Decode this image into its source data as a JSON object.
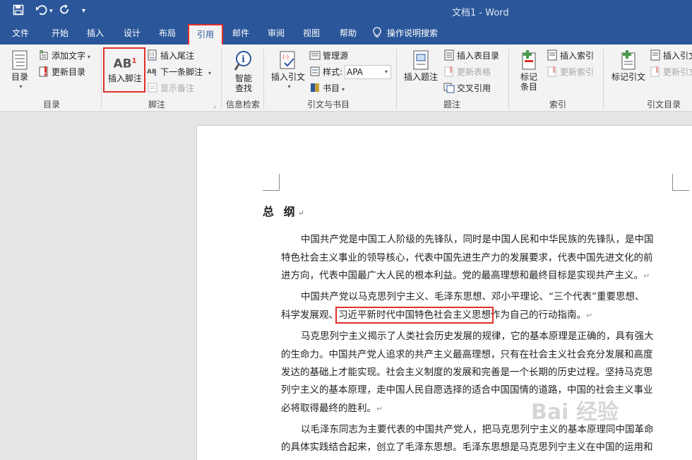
{
  "window": {
    "title": "文档1  -  Word"
  },
  "tabs": [
    "文件",
    "开始",
    "插入",
    "设计",
    "布局",
    "引用",
    "邮件",
    "审阅",
    "视图",
    "帮助"
  ],
  "tell_me": "操作说明搜索",
  "ribbon": {
    "toc": {
      "button": "目录",
      "add_text": "添加文字",
      "update_toc": "更新目录",
      "group": "目录"
    },
    "footnotes": {
      "insert_footnote": "插入脚注",
      "insert_endnote": "插入尾注",
      "next_footnote": "下一条脚注",
      "show_notes": "显示备注",
      "group": "脚注",
      "icon_text": "AB",
      "icon_sup": "1"
    },
    "research": {
      "smart_lookup_1": "智能",
      "smart_lookup_2": "查找",
      "group": "信息检索"
    },
    "citations": {
      "insert_citation": "插入引文",
      "manage_sources": "管理源",
      "style_label": "样式:",
      "style_value": "APA",
      "bibliography": "书目",
      "group": "引文与书目"
    },
    "captions": {
      "insert_caption": "插入题注",
      "insert_table_of_figures": "插入表目录",
      "update_table": "更新表格",
      "cross_reference": "交叉引用",
      "group": "题注"
    },
    "index": {
      "mark_entry_1": "标记",
      "mark_entry_2": "条目",
      "insert_index": "插入索引",
      "update_index": "更新索引",
      "group": "索引"
    },
    "toa": {
      "mark_citation": "标记引文",
      "insert_toa": "插入引文",
      "update_toa": "更新引文",
      "group": "引文目录"
    }
  },
  "document": {
    "title": "总  纲",
    "lines": [
      "中国共产党是中国工人阶级的先锋队，同时是中国人民和中华民族的先锋队，是中国",
      "特色社会主义事业的领导核心，代表中国先进生产力的发展要求，代表中国先进文化的前",
      "进方向，代表中国最广大人民的根本利益。党的最高理想和最终目标是实现共产主义。",
      "中国共产党以马克思列宁主义、毛泽东思想、邓小平理论、“三个代表”重要思想、",
      "科学发展观、",
      "习近平新时代中国特色社会主义思想",
      "作为自己的行动指南。",
      "马克思列宁主义揭示了人类社会历史发展的规律，它的基本原理是正确的，具有强大",
      "的生命力。中国共产党人追求的共产主义最高理想，只有在社会主义社会充分发展和高度",
      "发达的基础上才能实现。社会主义制度的发展和完善是一个长期的历史过程。坚持马克思",
      "列宁主义的基本原理，走中国人民自愿选择的适合中国国情的道路，中国的社会主义事业",
      "必将取得最终的胜利。",
      "以毛泽东同志为主要代表的中国共产党人，把马克思列宁主义的基本原理同中国革命",
      "的具体实践结合起来，创立了毛泽东思想。毛泽东思想是马克思列宁主义在中国的运用和"
    ],
    "watermark": "Bai 经验"
  },
  "colors": {
    "accent": "#2b579a",
    "highlight": "#e0302a"
  }
}
